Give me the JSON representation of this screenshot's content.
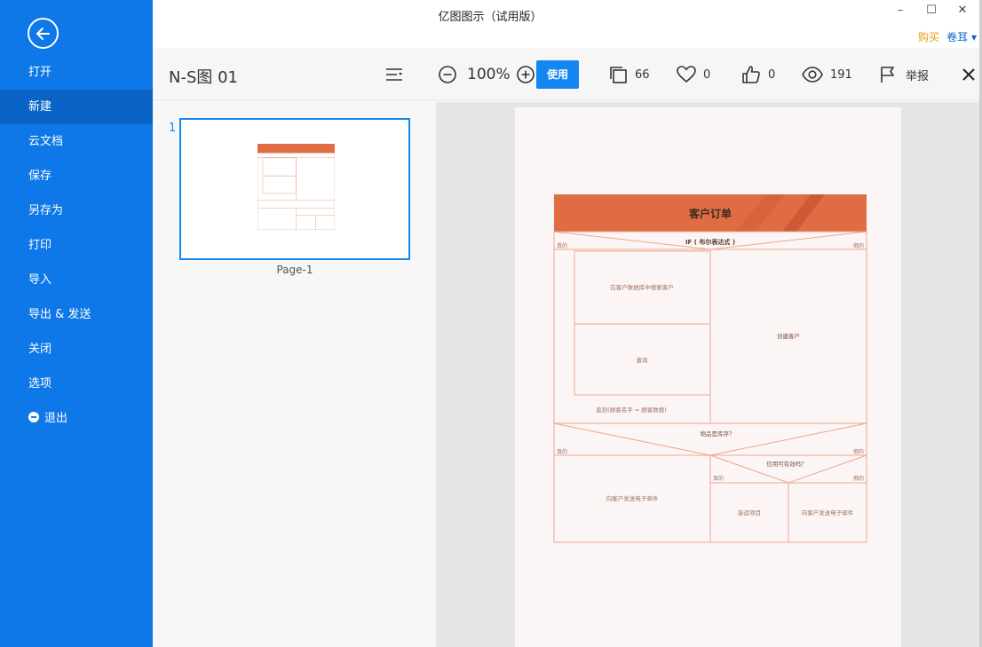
{
  "app": {
    "title": "亿图图示（试用版）",
    "buy_label": "购买",
    "user_label": "卷耳 ▾"
  },
  "window": {
    "minimize": "–",
    "maximize": "☐",
    "close": "✕"
  },
  "sidebar": {
    "items": [
      {
        "label": "打开"
      },
      {
        "label": "新建"
      },
      {
        "label": "云文档"
      },
      {
        "label": "保存"
      },
      {
        "label": "另存为"
      },
      {
        "label": "打印"
      },
      {
        "label": "导入"
      },
      {
        "label": "导出 & 发送"
      },
      {
        "label": "关闭"
      },
      {
        "label": "选项"
      },
      {
        "label": "退出"
      }
    ]
  },
  "toolbar": {
    "doc_title": "N-S图 01",
    "zoom": "100%",
    "use_label": "使用",
    "copies": "66",
    "likes": "0",
    "thumbs": "0",
    "views": "191",
    "report_label": "举报"
  },
  "pages": {
    "number": "1",
    "page_label": "Page-1"
  },
  "diagram": {
    "title": "客户订单",
    "if_condition": "IF ( 布尔表达式 )",
    "true_label": "真的",
    "false_label": "假的",
    "search_db": "在客户数据库中搜索客户",
    "query": "查询",
    "until": "直到(顾客名字 = 顾客数据)",
    "create_customer": "创建客户",
    "in_stock": "物品是库存？",
    "credit": "信用可有效吗？",
    "email_customer": "向客户发送电子邮件",
    "ship_item": "装运项目",
    "email_customer_2": "向客户发送电子邮件"
  },
  "colors": {
    "sidebar": "#0f78e8",
    "sidebar_active": "#0a63c7",
    "accent": "#1587f0",
    "diagram_header": "#e06c44",
    "diagram_line": "#eda58d"
  }
}
